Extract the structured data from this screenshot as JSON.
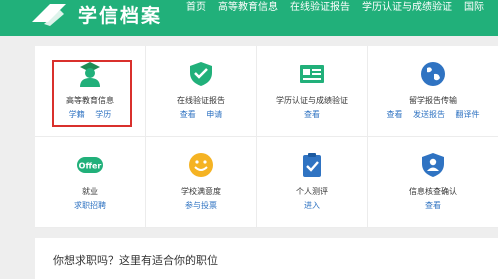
{
  "header": {
    "brand": "学信档案",
    "nav": [
      "首页",
      "高等教育信息",
      "在线验证报告",
      "学历认证与成绩验证",
      "国际"
    ]
  },
  "colors": {
    "header_bg": "#21b07a",
    "link": "#2f73c2",
    "highlight": "#d9302c"
  },
  "grid": {
    "items": [
      {
        "icon": "graduate-student-icon",
        "label": "高等教育信息",
        "links": [
          "学籍",
          "学历"
        ]
      },
      {
        "icon": "shield-check-icon",
        "label": "在线验证报告",
        "links": [
          "查看",
          "申请"
        ]
      },
      {
        "icon": "id-card-icon",
        "label": "学历认证与成绩验证",
        "links": [
          "查看"
        ]
      },
      {
        "icon": "globe-icon",
        "label": "留学报告传输",
        "links": [
          "查看",
          "发送报告",
          "翻译件"
        ]
      },
      {
        "icon": "offer-badge-icon",
        "label": "就业",
        "links": [
          "求职招聘"
        ]
      },
      {
        "icon": "smiley-face-icon",
        "label": "学校满意度",
        "links": [
          "参与投票"
        ]
      },
      {
        "icon": "clipboard-check-icon",
        "label": "个人测评",
        "links": [
          "进入"
        ]
      },
      {
        "icon": "person-shield-icon",
        "label": "信息核查确认",
        "links": [
          "查看"
        ]
      }
    ],
    "offer_text": "Offer"
  },
  "job_prompt": "你想求职吗？这里有适合你的职位"
}
